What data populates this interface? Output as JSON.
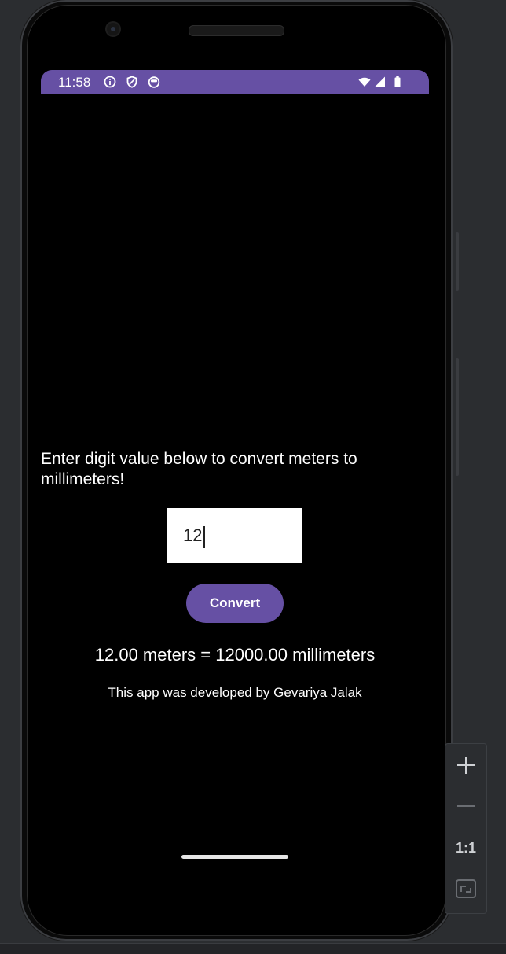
{
  "status_bar": {
    "time": "11:58",
    "icons": [
      "info-icon",
      "shield-icon",
      "face-icon",
      "wifi-icon",
      "signal-icon",
      "battery-icon"
    ],
    "color": "#6650a4"
  },
  "main": {
    "prompt": "Enter digit value below to convert meters to millimeters!",
    "input_value": "12",
    "convert_label": "Convert",
    "result": "12.00 meters = 12000.00 millimeters",
    "credit": "This app was developed by Gevariya Jalak"
  },
  "zoom_controls": {
    "items": [
      "zoom-in-icon",
      "zoom-out-icon",
      "actual-size",
      "fit-screen-icon"
    ],
    "actual_size_label": "1:1"
  },
  "colors": {
    "accent": "#6650a4",
    "background": "#000000",
    "ide_background": "#2b2d30"
  }
}
